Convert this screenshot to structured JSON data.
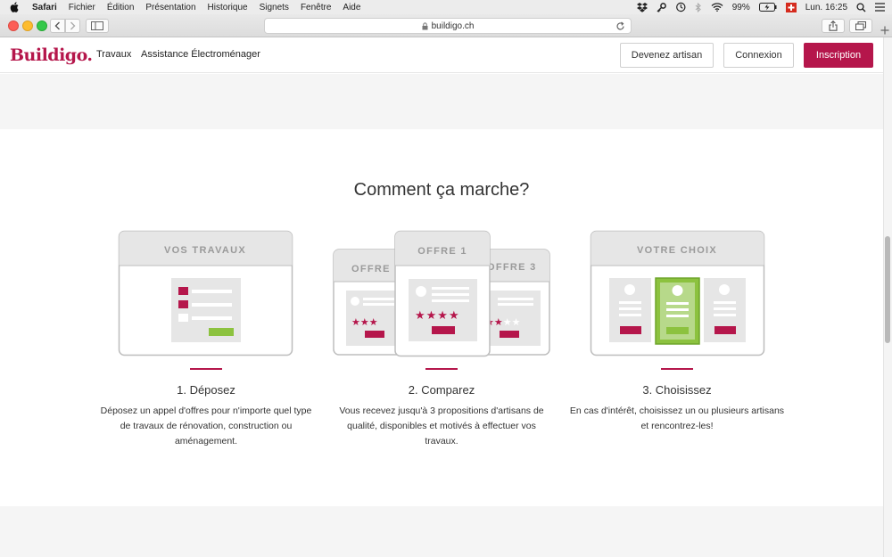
{
  "menubar": {
    "items": [
      "Safari",
      "Fichier",
      "Édition",
      "Présentation",
      "Historique",
      "Signets",
      "Fenêtre",
      "Aide"
    ],
    "battery": "99%",
    "clock": "Lun. 16:25"
  },
  "browser": {
    "url": "buildigo.ch"
  },
  "site": {
    "logo": "Buildigo.",
    "nav": [
      "Travaux",
      "Assistance Électroménager"
    ],
    "buttons": {
      "artisan": "Devenez artisan",
      "connexion": "Connexion",
      "inscription": "Inscription"
    },
    "accent": "#b5164b"
  },
  "how": {
    "title": "Comment ça marche?",
    "steps": [
      {
        "card_label": "VOS TRAVAUX",
        "title": "1. Déposez",
        "desc": "Déposez un appel d'offres pour n'importe quel type de travaux de rénovation, construction ou aménagement."
      },
      {
        "card_labels": [
          "OFFRE 2",
          "OFFRE 1",
          "OFFRE 3"
        ],
        "title": "2. Comparez",
        "desc": "Vous recevez jusqu'à 3 propositions d'artisans de qualité, disponibles et motivés à effectuer vos travaux."
      },
      {
        "card_label": "VOTRE CHOIX",
        "title": "3. Choisissez",
        "desc": "En cas d'intérêt, choisissez un ou plusieurs artisans et rencontrez-les!"
      }
    ]
  }
}
